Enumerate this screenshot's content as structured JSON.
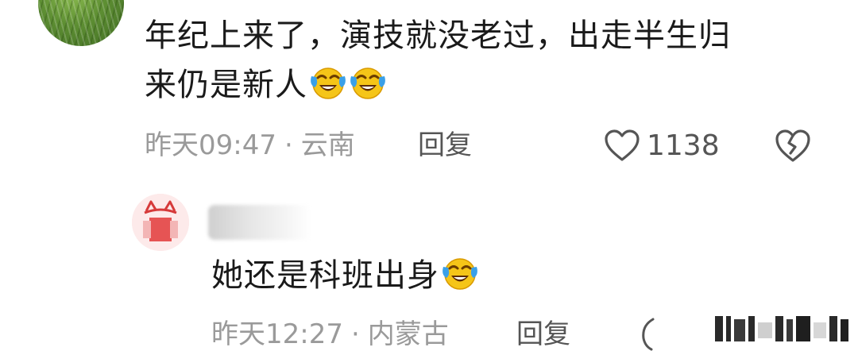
{
  "comment": {
    "line1": "年纪上来了，演技就没老过，出走半生归",
    "line2": "来仍是新人",
    "emoji_count": 2,
    "emoji_icon": "laughing-crying-emoji-icon",
    "time": "昨天09:47",
    "separator": "·",
    "location": "云南",
    "reply_label": "回复",
    "like_count": "1138"
  },
  "reply": {
    "text": "她还是科班出身",
    "emoji_icon": "laughing-crying-emoji-icon",
    "time": "昨天12:27",
    "separator": "·",
    "location": "内蒙古",
    "reply_label": "回复"
  },
  "colors": {
    "text_primary": "#1a1a1a",
    "text_secondary": "#9a9a9a",
    "action": "#555555",
    "emoji_face": "#f5c518",
    "emoji_tear": "#3aa0e8"
  }
}
